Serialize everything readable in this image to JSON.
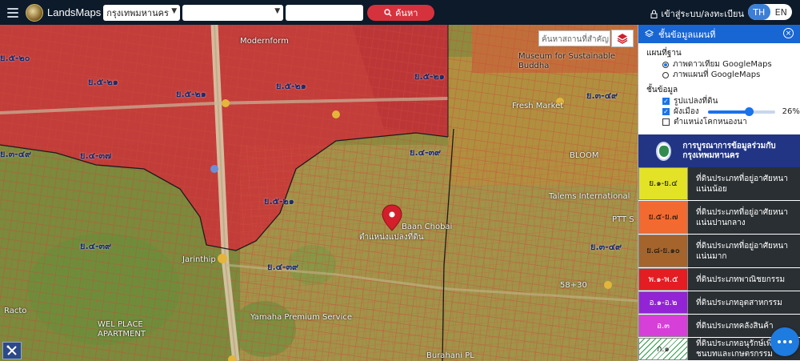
{
  "app": {
    "brand": "LandsMaps",
    "province_select": "กรุงเทพมหานคร",
    "district_select": "",
    "search_text": "",
    "search_button": "ค้นหา",
    "login": "เข้าสู่ระบบ/ลงทะเบียน",
    "lang_th": "TH",
    "lang_en": "EN"
  },
  "map": {
    "place_search_placeholder": "ค้นหาสถานที่สำคัญ",
    "marker_label": "ตำแหน่งแปลงที่ดิน",
    "zone_labels": [
      "ย.๕-๒๐",
      "ย.๕-๒๑",
      "ย.๕-๒๑",
      "ย.๓-๔๙",
      "ย.๔-๓๗",
      "ย.๔-๓๙",
      "ย.๕-๒๑",
      "ย.๔-๓๙",
      "ย.๓-๔๙",
      "ย.๔-๓๙",
      "ย.๕-๒๐",
      "ย.๔-๓๙",
      "ย.๓-๔๙"
    ],
    "places": [
      "Modernform",
      "Museum for Sustainable",
      "Buddha",
      "Fresh Market",
      "BLOOM",
      "Talems International",
      "PTT S",
      "Baan Chobai",
      "Jarinthip",
      "Yamaha Premium Service",
      "WEL PLACE",
      "APARTMENT",
      "Burahani PL",
      "58+30",
      "Racto"
    ],
    "colors": {
      "red_zone": "#d3373a",
      "orange_zone": "#d88a2e",
      "yellow_zone": "#cfa53a",
      "boundary": "#1b1b1b",
      "marker": "#d21f2b"
    }
  },
  "panel": {
    "title": "ชั้นข้อมูลแผนที่",
    "basemap_title": "แผนที่ฐาน",
    "basemap_options": [
      {
        "label": "ภาพดาวเทียม GoogleMaps",
        "selected": true
      },
      {
        "label": "ภาพแผนที่ GoogleMaps",
        "selected": false
      }
    ],
    "layers_title": "ชั้นข้อมูล",
    "layers": [
      {
        "label": "รูปแปลงที่ดิน",
        "checked": true
      },
      {
        "label": "ผังเมือง",
        "checked": true,
        "opacity_percent": 26,
        "opacity_text": "26%"
      },
      {
        "label": "ตำแหน่งโคกหนองนา",
        "checked": false
      }
    ],
    "legend_title": "การบูรณาการข้อมูลร่วมกับ กรุงเทพมหานคร",
    "legend": [
      {
        "code": "ย.๑-ย.๔",
        "color": "#e3e227",
        "desc": "ที่ดินประเภทที่อยู่อาศัยหนาแน่นน้อย"
      },
      {
        "code": "ย.๕-ย.๗",
        "color": "#f26a30",
        "desc": "ที่ดินประเภทที่อยู่อาศัยหนาแน่นปานกลาง"
      },
      {
        "code": "ย.๘-ย.๑๐",
        "color": "#a4642c",
        "desc": "ที่ดินประเภทที่อยู่อาศัยหนาแน่นมาก"
      },
      {
        "code": "พ.๑-พ.๕",
        "color": "#e31d22",
        "desc": "ที่ดินประเภทพาณิชยกรรม"
      },
      {
        "code": "อ.๑-อ.๒",
        "color": "#9224d6",
        "desc": "ที่ดินประเภทอุตสาหกรรม"
      },
      {
        "code": "อ.๓",
        "color": "#d63fd8",
        "desc": "ที่ดินประเภทคลังสินค้า"
      },
      {
        "code": "ก.๑",
        "color": "#ffffff",
        "desc": "ที่ดินประเภทอนุรักษ์เพื่อชนบทและเกษตรกรรม"
      }
    ]
  }
}
